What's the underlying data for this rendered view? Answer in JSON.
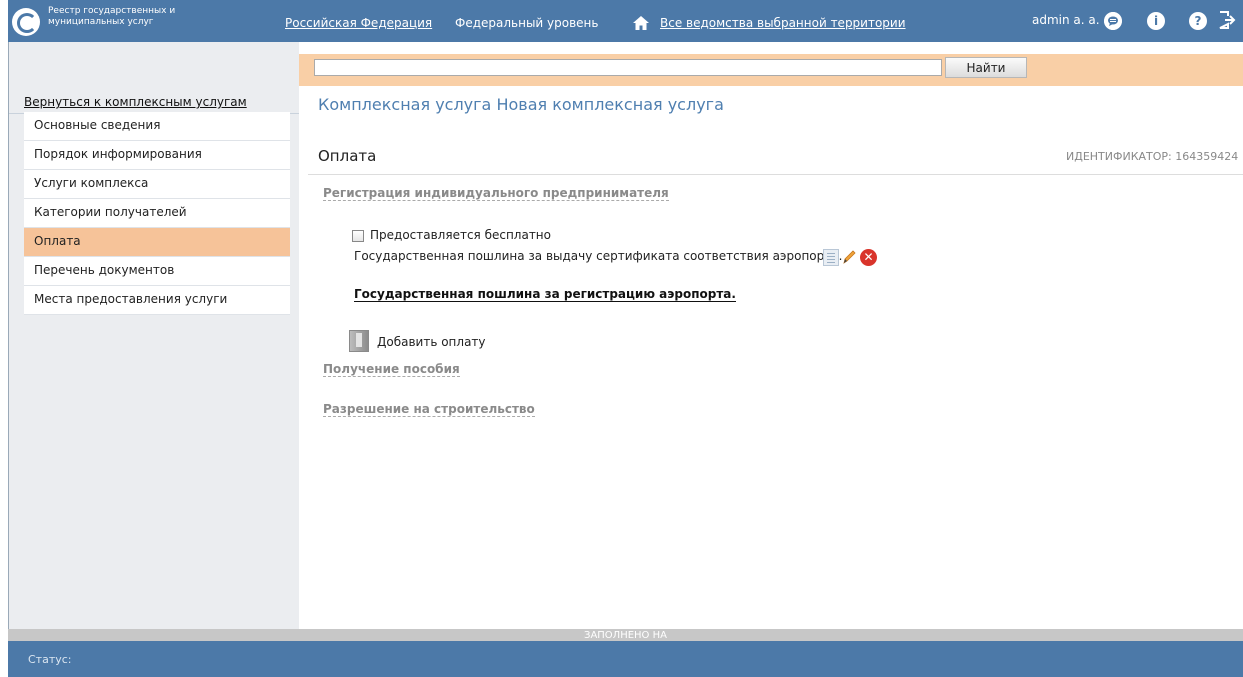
{
  "header": {
    "app_title": "Реестр государственных и муниципальных услуг",
    "region": "Российская Федерация",
    "level": "Федеральный уровень",
    "agencies": "Все ведомства выбранной территории",
    "user": "admin a. a.",
    "icons": [
      "logo-icon",
      "home-icon",
      "chat-icon",
      "info-icon",
      "help-icon",
      "exit-icon"
    ],
    "info_glyph": "i",
    "help_glyph": "?"
  },
  "sidebar": {
    "back_link": "Вернуться к комплексным услугам",
    "items": [
      {
        "label": "Основные сведения",
        "active": false
      },
      {
        "label": "Порядок информирования",
        "active": false
      },
      {
        "label": "Услуги комплекса",
        "active": false
      },
      {
        "label": "Категории получателей",
        "active": false
      },
      {
        "label": "Оплата",
        "active": true
      },
      {
        "label": "Перечень документов",
        "active": false
      },
      {
        "label": "Места предоставления услуги",
        "active": false
      }
    ]
  },
  "search": {
    "value": "",
    "button_label": "Найти"
  },
  "main": {
    "page_title": "Комплексная услуга Новая комплексная услуга",
    "section_title": "Оплата",
    "identifier": "ИДЕНТИФИКАТОР: 164359424",
    "groups": [
      "Регистрация индивидуального предпринимателя",
      "Получение пособия",
      "Разрешение на строительство"
    ],
    "free_label": "Предоставляется бесплатно",
    "fee_1": "Государственная пошлина за выдачу сертификата соответствия аэропорта.",
    "fee_2": "Государственная пошлина за регистрацию аэропорта.",
    "add_payment": "Добавить оплату",
    "delete_glyph": "✕"
  },
  "footer": {
    "filled_label": "ЗАПОЛНЕНО НА",
    "status_label": "Статус:"
  },
  "colors": {
    "header_blue": "#4c79a8",
    "active_orange": "#f6c399",
    "search_strip": "#f9cfa6"
  }
}
